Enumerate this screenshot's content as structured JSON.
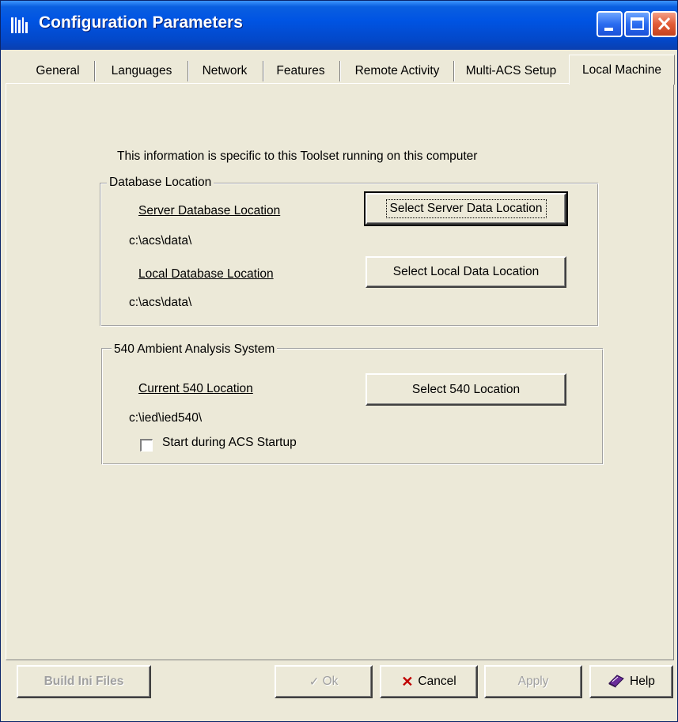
{
  "window": {
    "title": "Configuration Parameters"
  },
  "tabs": [
    {
      "label": "General"
    },
    {
      "label": "Languages"
    },
    {
      "label": "Network"
    },
    {
      "label": "Features"
    },
    {
      "label": "Remote Activity"
    },
    {
      "label": "Multi-ACS Setup"
    },
    {
      "label": "Local Machine",
      "active": true
    }
  ],
  "main": {
    "info_text": "This information is specific to this Toolset running on this  computer",
    "database_group": {
      "legend": "Database Location",
      "server_label": "Server Database Location",
      "server_path": "c:\\acs\\data\\",
      "server_button": "Select Server Data Location",
      "local_label": "Local Database Location",
      "local_path": "c:\\acs\\data\\",
      "local_button": "Select Local Data Location"
    },
    "ambient_group": {
      "legend": "540 Ambient Analysis System",
      "current_label": "Current 540 Location",
      "current_path": "c:\\ied\\ied540\\",
      "select_button": "Select 540 Location",
      "startup_checkbox_label": "Start during ACS Startup",
      "startup_checked": false
    }
  },
  "footer": {
    "build_ini_label": "Build Ini Files",
    "ok_label": "Ok",
    "cancel_label": "Cancel",
    "apply_label": "Apply",
    "help_label": "Help"
  },
  "colors": {
    "titlebar": "#0054E3",
    "face": "#ECE9D8",
    "cancel_x": "#C00000"
  }
}
